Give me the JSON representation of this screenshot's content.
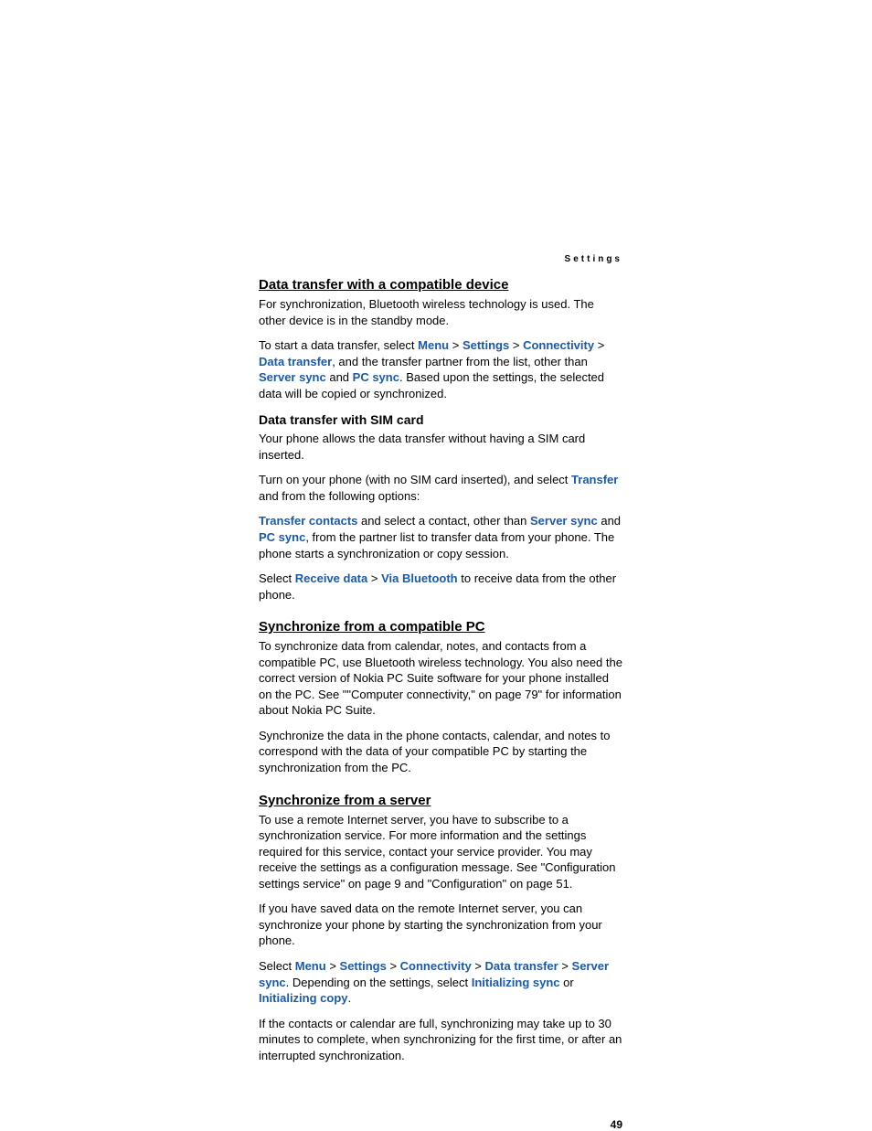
{
  "header": "Settings",
  "pageNumber": "49",
  "sections": [
    {
      "title": "Data transfer with a compatible device",
      "paras": [
        [
          {
            "t": "For synchronization, Bluetooth wireless technology is used. The other device is in the standby mode."
          }
        ],
        [
          {
            "t": "To start a data transfer, select "
          },
          {
            "t": "Menu",
            "hl": true
          },
          {
            "t": " > "
          },
          {
            "t": "Settings",
            "hl": true
          },
          {
            "t": " > "
          },
          {
            "t": "Connectivity",
            "hl": true
          },
          {
            "t": " > "
          },
          {
            "t": "Data transfer",
            "hl": true
          },
          {
            "t": ", and the transfer partner from the list, other than "
          },
          {
            "t": "Server sync",
            "hl": true
          },
          {
            "t": " and "
          },
          {
            "t": "PC sync",
            "hl": true
          },
          {
            "t": ". Based upon the settings, the selected data will be copied or synchronized."
          }
        ]
      ],
      "sub": {
        "title": "Data transfer with SIM card",
        "paras": [
          [
            {
              "t": "Your phone allows the data transfer without having a SIM card inserted."
            }
          ],
          [
            {
              "t": "Turn on your phone (with no SIM card inserted), and select "
            },
            {
              "t": "Transfer",
              "hl": true
            },
            {
              "t": " and from the following options:"
            }
          ],
          [
            {
              "t": "Transfer contacts",
              "hl": true
            },
            {
              "t": " and select a contact, other than "
            },
            {
              "t": "Server sync",
              "hl": true
            },
            {
              "t": " and "
            },
            {
              "t": "PC sync",
              "hl": true
            },
            {
              "t": ", from the partner list to transfer data from your phone. The phone starts a synchronization or copy session."
            }
          ],
          [
            {
              "t": "Select "
            },
            {
              "t": "Receive data",
              "hl": true
            },
            {
              "t": " > "
            },
            {
              "t": "Via Bluetooth",
              "hl": true
            },
            {
              "t": " to receive data from the other phone."
            }
          ]
        ]
      }
    },
    {
      "title": "Synchronize from a compatible PC",
      "paras": [
        [
          {
            "t": "To synchronize data from calendar, notes, and contacts from a compatible PC, use Bluetooth wireless technology. You also need the correct version of Nokia PC Suite software for your phone installed on the PC. See \"\"Computer connectivity,\" on page 79\" for information about Nokia PC Suite."
          }
        ],
        [
          {
            "t": "Synchronize the data in the phone contacts, calendar, and notes to correspond with the data of your compatible PC by starting the synchronization from the PC."
          }
        ]
      ]
    },
    {
      "title": "Synchronize from a server",
      "paras": [
        [
          {
            "t": "To use a remote Internet server, you have to subscribe to a synchronization service. For more information and the settings required for this service, contact your service provider. You may receive the settings as a configuration message. See \"Configuration settings service\" on page 9 and \"Configuration\" on page 51."
          }
        ],
        [
          {
            "t": "If you have saved data on the remote Internet server, you can synchronize your phone by starting the synchronization from your phone."
          }
        ],
        [
          {
            "t": "Select "
          },
          {
            "t": "Menu",
            "hl": true
          },
          {
            "t": " > "
          },
          {
            "t": "Settings",
            "hl": true
          },
          {
            "t": " > "
          },
          {
            "t": "Connectivity",
            "hl": true
          },
          {
            "t": " > "
          },
          {
            "t": "Data transfer",
            "hl": true
          },
          {
            "t": " > "
          },
          {
            "t": "Server sync",
            "hl": true
          },
          {
            "t": ". Depending on the settings, select "
          },
          {
            "t": "Initializing sync",
            "hl": true
          },
          {
            "t": " or "
          },
          {
            "t": "Initializing copy",
            "hl": true
          },
          {
            "t": "."
          }
        ],
        [
          {
            "t": "If the contacts or calendar are full, synchronizing may take up to 30 minutes to complete, when synchronizing for the first time, or after an interrupted synchronization."
          }
        ]
      ]
    }
  ]
}
